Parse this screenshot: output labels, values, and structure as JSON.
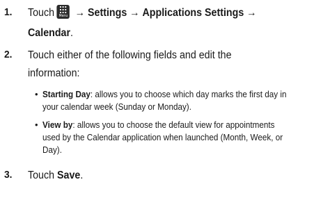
{
  "steps": [
    {
      "number": "1.",
      "prefix": "Touch",
      "icon": "menu-icon",
      "icon_label": "Menu",
      "arrow": "→",
      "path": [
        "Settings",
        "Applications Settings",
        "Calendar"
      ],
      "suffix": "."
    },
    {
      "number": "2.",
      "line1": "Touch either of the following fields and edit the",
      "line2": "information:"
    },
    {
      "number": "3.",
      "prefix": "Touch",
      "action": "Save",
      "suffix": "."
    }
  ],
  "bullets": [
    {
      "term": "Starting Day",
      "line1": ": allows you to choose which day marks the first day in",
      "line2": "your calendar week (Sunday or Monday)."
    },
    {
      "term": "View by",
      "line1": ": allows you to choose the default view for appointments",
      "line2": "used by the Calendar application when launched (Month, Week, or",
      "line3": "Day)."
    }
  ]
}
